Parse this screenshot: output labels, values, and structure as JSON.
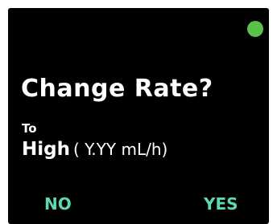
{
  "dialog": {
    "title": "Change Rate?",
    "to_label": "To",
    "rate_name": "High",
    "rate_value": "( Y.YY mL/h)"
  },
  "buttons": {
    "no_label": "NO",
    "yes_label": "YES"
  },
  "status": {
    "indicator_icon": "status-dot-icon",
    "indicator_color": "#5bbf4a"
  },
  "colors": {
    "background": "#000000",
    "text": "#ffffff",
    "button_accent": "#5cd8b2"
  }
}
